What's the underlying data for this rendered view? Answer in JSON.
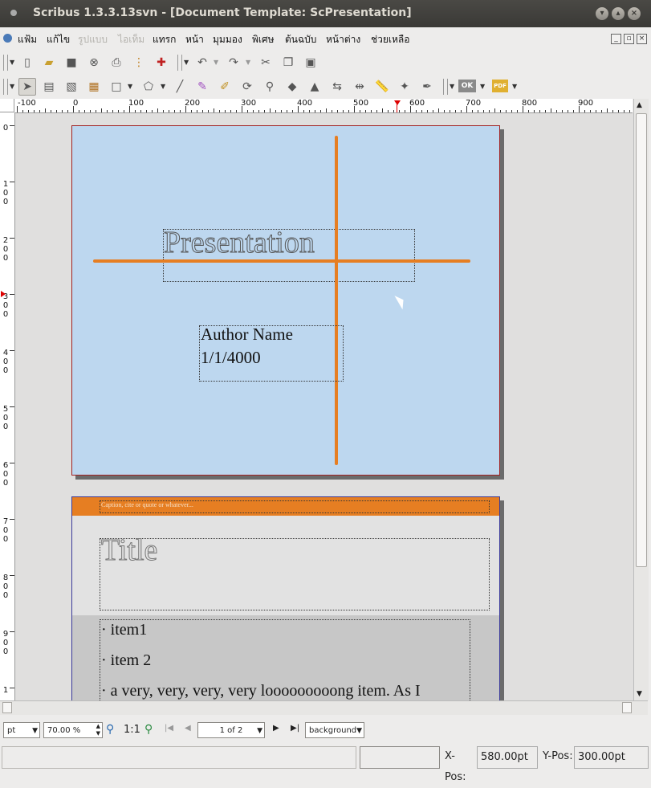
{
  "window": {
    "title": "Scribus 1.3.3.13svn - [Document Template: ScPresentation]"
  },
  "menubar": {
    "items": [
      {
        "label": "แฟ้ม",
        "enabled": true
      },
      {
        "label": "แก้ไข",
        "enabled": true
      },
      {
        "label": "รูปแบบ",
        "enabled": false
      },
      {
        "label": "ไอเท็ม",
        "enabled": false
      },
      {
        "label": "แทรก",
        "enabled": true
      },
      {
        "label": "หน้า",
        "enabled": true
      },
      {
        "label": "มุมมอง",
        "enabled": true
      },
      {
        "label": "พิเศษ",
        "enabled": true
      },
      {
        "label": "ต้นฉบับ",
        "enabled": true
      },
      {
        "label": "หน้าต่าง",
        "enabled": true
      },
      {
        "label": "ช่วยเหลือ",
        "enabled": true
      }
    ]
  },
  "toolbar2": {
    "ok_label": "OK",
    "pdf_label": "PDF"
  },
  "ruler": {
    "h_labels": [
      "-100",
      "0",
      "100",
      "200",
      "300",
      "400",
      "500",
      "600",
      "700",
      "800",
      "900"
    ],
    "v_labels": [
      "0",
      "100",
      "200",
      "300",
      "400",
      "500",
      "600",
      "700",
      "800",
      "900",
      "1"
    ]
  },
  "page1": {
    "title_text": "Presentation",
    "author_line1": "Author Name",
    "author_line2": "1/1/4000"
  },
  "page2": {
    "caption": "Caption, cite or quote or whatever...",
    "title": "Title",
    "items": [
      "· item1",
      "· item 2",
      "· a very, very, very, very looooooooong item. As I"
    ]
  },
  "bottombar": {
    "unit": "pt",
    "zoom": "70.00 %",
    "zoom_one": "1:1",
    "page_indicator": "1 of 2",
    "layer": "background"
  },
  "statusbar": {
    "xpos_label": "X-Pos:",
    "xpos_value": "580.00pt",
    "ypos_label": "Y-Pos:",
    "ypos_value": "300.00pt"
  },
  "colors": {
    "page_bg": "#bdd7ef",
    "orange": "#e67e22",
    "page_border": "#a02020"
  }
}
